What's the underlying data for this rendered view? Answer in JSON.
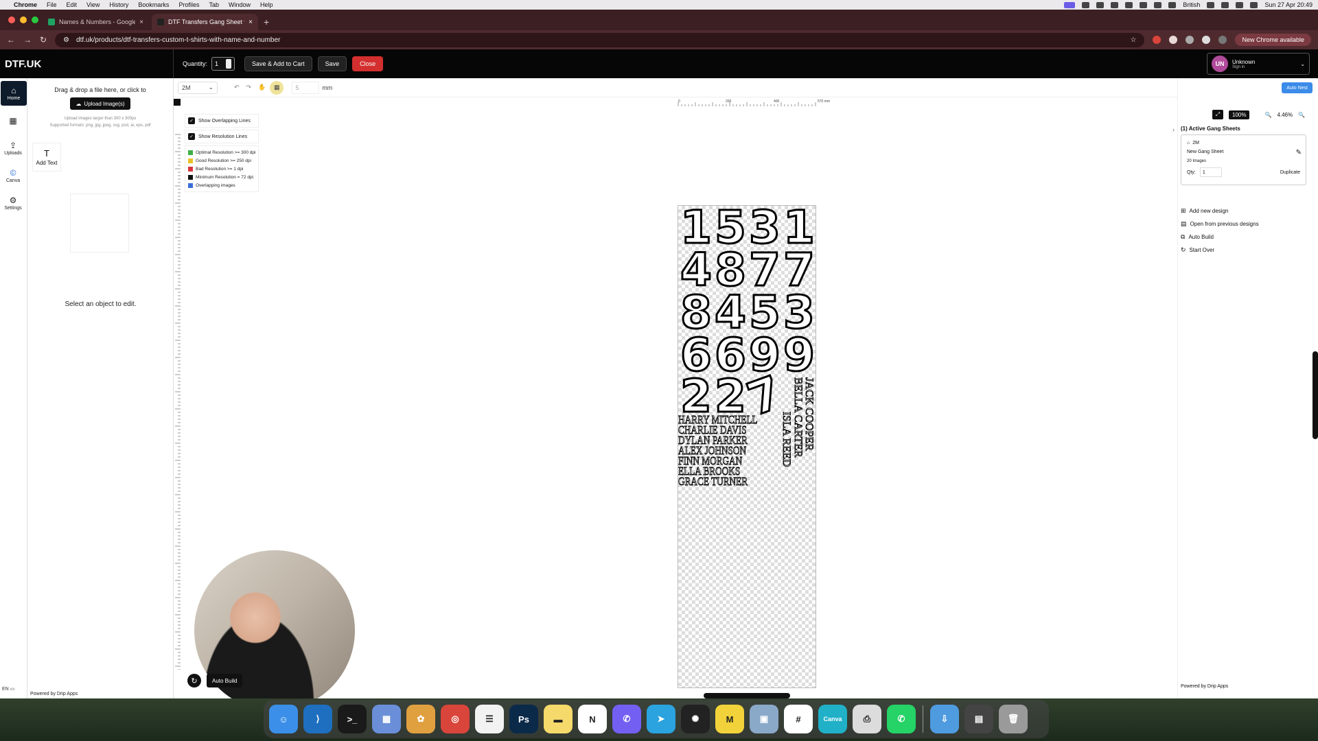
{
  "menubar": {
    "app": "Chrome",
    "items": [
      "File",
      "Edit",
      "View",
      "History",
      "Bookmarks",
      "Profiles",
      "Tab",
      "Window",
      "Help"
    ],
    "keyboard": "British",
    "datetime": "Sun 27 Apr 20:49"
  },
  "browser": {
    "tabs": [
      {
        "label": "Names & Numbers - Google Sh",
        "favicon_color": "#1ea362"
      },
      {
        "label": "DTF Transfers Gang Sheet wit",
        "favicon_color": "#222222"
      }
    ],
    "url": "dtf.uk/products/dtf-transfers-custom-t-shirts-with-name-and-number",
    "update_label": "New Chrome available"
  },
  "header": {
    "brand": "DTF.UK",
    "quantity_label": "Quantity:",
    "quantity_value": "1",
    "save_add_cart": "Save & Add to Cart",
    "save": "Save",
    "close": "Close",
    "user_initials": "UN",
    "user_name": "Unknown",
    "user_action": "Sign in"
  },
  "rail": {
    "items": [
      {
        "label": "Home",
        "icon": "home-icon",
        "glyph": "⌂"
      },
      {
        "label": "",
        "icon": "tshirt-icon",
        "glyph": "▦"
      },
      {
        "label": "Uploads",
        "icon": "upload-icon",
        "glyph": "⇪"
      },
      {
        "label": "Canva",
        "icon": "canva-icon",
        "glyph": "©"
      },
      {
        "label": "Settings",
        "icon": "gear-icon",
        "glyph": "⚙"
      }
    ],
    "lang": "EN"
  },
  "left_panel": {
    "drop_text": "Drag & drop a file here, or click to",
    "upload_button": "Upload Image(s)",
    "note1": "Upload images larger than 300 x 300px",
    "note2": "Supported formats: png, jpg, jpeg, svg, psd, ai, eps, pdf",
    "add_text": "Add Text",
    "select_prompt": "Select an object to edit.",
    "powered": "Powered by Drip Apps"
  },
  "toolbar": {
    "size_option": "2M",
    "gap_value": "5",
    "unit": "mm"
  },
  "ruler_labels": [
    "0",
    "200",
    "400",
    "570 mm"
  ],
  "options": {
    "show_overlapping": "Show Overlapping Lines",
    "show_resolution": "Show Resolution Lines",
    "legend": [
      {
        "label": "Optimal Resolution >= 300 dpi",
        "color": "#3fae49"
      },
      {
        "label": "Good Resolution >= 250 dpi",
        "color": "#e8c12a"
      },
      {
        "label": "Bad Resolution >= 1 dpi",
        "color": "#d9343a"
      },
      {
        "label": "Minimum Resolution = 72 dpi",
        "color": "#111111"
      },
      {
        "label": "Overlapping images",
        "color": "#3b6fd8"
      }
    ]
  },
  "gang_sheet": {
    "number_rows": [
      [
        "1",
        "5",
        "3",
        "1"
      ],
      [
        "4",
        "8",
        "7",
        "7"
      ],
      [
        "8",
        "4",
        "5",
        "3"
      ],
      [
        "6",
        "6",
        "9",
        "9"
      ],
      [
        "2",
        "2",
        "7",
        ""
      ]
    ],
    "names_horizontal": [
      "HARRY MITCHELL",
      "CHARLIE DAVIS",
      "DYLAN PARKER",
      "ALEX JOHNSON",
      "FINN MORGAN",
      "ELLA BROOKS",
      "GRACE TURNER"
    ],
    "names_vertical": [
      "JACK COOPER",
      "BELLA CARTER",
      "ISLA REED"
    ]
  },
  "canvas_footer": {
    "auto_build": "Auto Build"
  },
  "right_panel": {
    "auto_nest": "Auto Nest",
    "zoom_fit": "100%",
    "zoom_level": "4.46%",
    "heading": "(1) Active Gang Sheets",
    "card_size": "2M",
    "card_title": "New Gang Sheet",
    "card_images": "20 Images",
    "qty_label": "Qty:",
    "qty_value": "1",
    "duplicate": "Duplicate",
    "actions": [
      {
        "label": "Add new design",
        "icon": "add-design-icon",
        "glyph": "⊞"
      },
      {
        "label": "Open from previous designs",
        "icon": "folder-icon",
        "glyph": "▤"
      },
      {
        "label": "Auto Build",
        "icon": "build-icon",
        "glyph": "⧉"
      },
      {
        "label": "Start Over",
        "icon": "restart-icon",
        "glyph": "↻"
      }
    ],
    "powered": "Powered by Drip Apps"
  },
  "dock": {
    "apps": [
      {
        "name": "finder-icon",
        "color": "#3b8fe8",
        "glyph": "☺"
      },
      {
        "name": "vscode-icon",
        "color": "#1e6fbf",
        "glyph": "⟩"
      },
      {
        "name": "terminal-icon",
        "color": "#1a1a1a",
        "glyph": ">_"
      },
      {
        "name": "launchpad-icon",
        "color": "#6a8fd8",
        "glyph": "▦"
      },
      {
        "name": "photos-icon",
        "color": "#e0a040",
        "glyph": "✿"
      },
      {
        "name": "chrome-icon",
        "color": "#d9453a",
        "glyph": "◎"
      },
      {
        "name": "reminders-icon",
        "color": "#f2f2f2",
        "glyph": "☰"
      },
      {
        "name": "photoshop-icon",
        "color": "#0b2a4a",
        "glyph": "Ps"
      },
      {
        "name": "notes-icon",
        "color": "#f5d96a",
        "glyph": "▬"
      },
      {
        "name": "notion-icon",
        "color": "#ffffff",
        "glyph": "N"
      },
      {
        "name": "viber-icon",
        "color": "#7360f2",
        "glyph": "✆"
      },
      {
        "name": "telegram-icon",
        "color": "#2aa3de",
        "glyph": "➤"
      },
      {
        "name": "chatgpt-icon",
        "color": "#222222",
        "glyph": "✺"
      },
      {
        "name": "miro-icon",
        "color": "#f2d23a",
        "glyph": "M"
      },
      {
        "name": "preview-icon",
        "color": "#8aa8c8",
        "glyph": "▣"
      },
      {
        "name": "slack-icon",
        "color": "#ffffff",
        "glyph": "#"
      },
      {
        "name": "canva-app-icon",
        "color": "#20b0c8",
        "glyph": "Canva"
      },
      {
        "name": "printer-icon",
        "color": "#dcdcdc",
        "glyph": "⎙"
      },
      {
        "name": "whatsapp-icon",
        "color": "#25d366",
        "glyph": "✆"
      },
      {
        "name": "downloads-icon",
        "color": "#4f9be0",
        "glyph": "⇩"
      },
      {
        "name": "recent-icon",
        "color": "#444444",
        "glyph": "▤"
      },
      {
        "name": "trash-icon",
        "color": "#9a9a9a",
        "glyph": "🗑"
      }
    ]
  }
}
